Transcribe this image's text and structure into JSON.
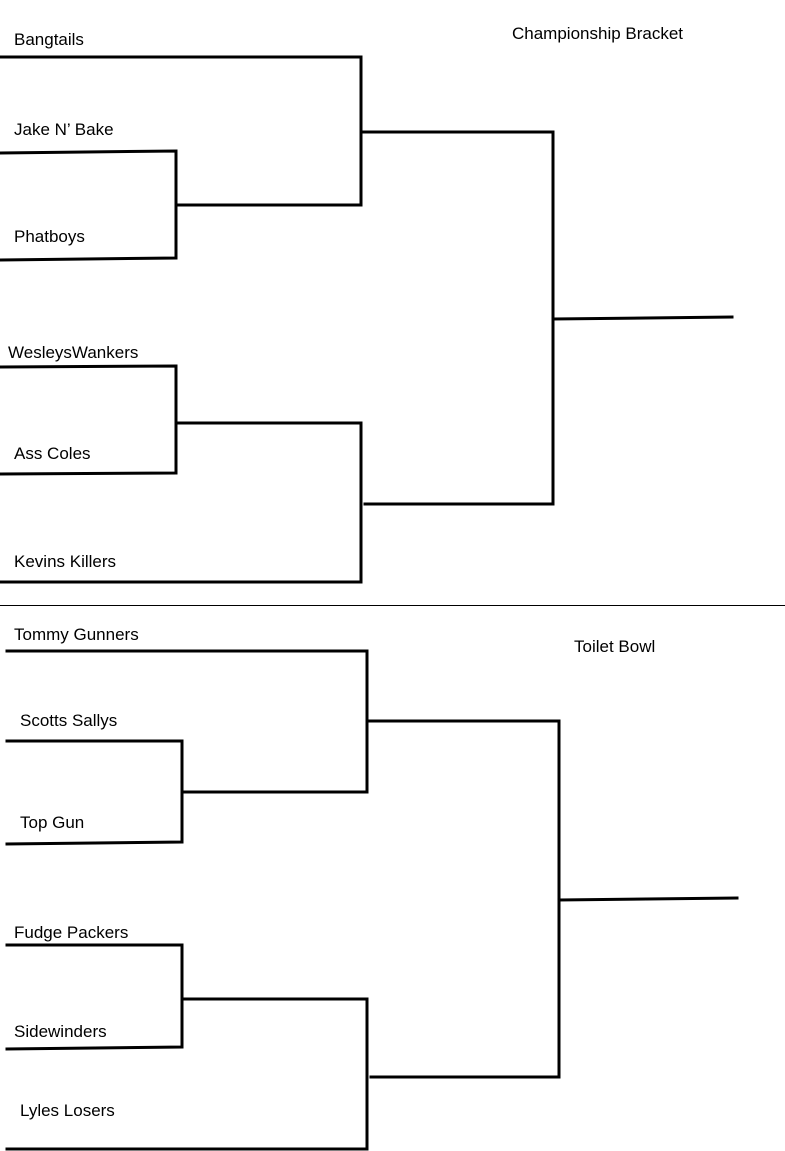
{
  "championship": {
    "title": "Championship Bracket",
    "teams": [
      "Bangtails",
      "Jake N’ Bake",
      "Phatboys",
      "WesleysWankers",
      "Ass Coles",
      "Kevins Killers"
    ]
  },
  "toilet_bowl": {
    "title": "Toilet Bowl",
    "teams": [
      "Tommy Gunners",
      "Scotts Sallys",
      "Top Gun",
      "Fudge Packers",
      "Sidewinders",
      "Lyles Losers"
    ]
  },
  "colors": {
    "line": "#000000",
    "background": "#ffffff"
  }
}
